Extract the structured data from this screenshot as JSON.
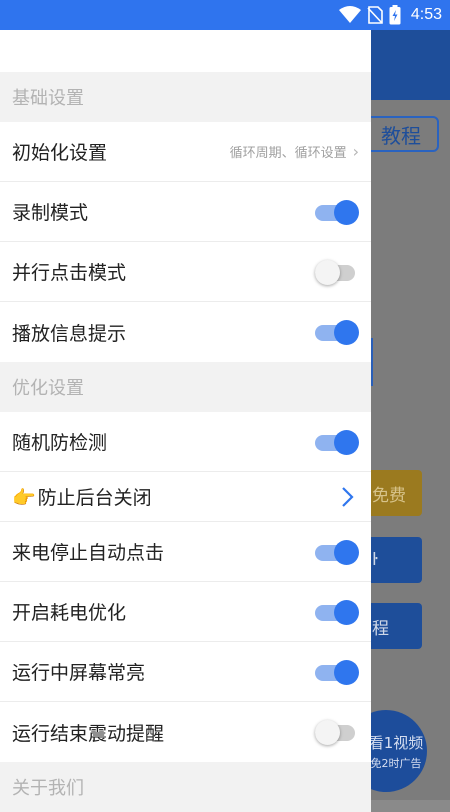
{
  "status_bar": {
    "time": "4:53"
  },
  "background_app": {
    "tutorial_button": "教程",
    "btn_free": "免费",
    "btn_a": "ŀ",
    "btn_b": "程",
    "circle_line1": "看1视频",
    "circle_line2": "免2时广告"
  },
  "drawer": {
    "sections": {
      "basic": "基础设置",
      "optimize": "优化设置",
      "about": "关于我们"
    },
    "basic_items": [
      {
        "label": "初始化设置",
        "hint": "循环周期、循环设置"
      },
      {
        "label": "录制模式",
        "toggle": "on"
      },
      {
        "label": "并行点击模式",
        "toggle": "off"
      },
      {
        "label": "播放信息提示",
        "toggle": "on"
      }
    ],
    "optimize_items": [
      {
        "label": "随机防检测",
        "toggle": "on"
      },
      {
        "label": "防止后台关闭",
        "icon": "pointing-hand-icon"
      },
      {
        "label": "来电停止自动点击",
        "toggle": "on"
      },
      {
        "label": "开启耗电优化",
        "toggle": "on"
      },
      {
        "label": "运行中屏幕常亮",
        "toggle": "on"
      },
      {
        "label": "运行结束震动提醒",
        "toggle": "off"
      }
    ]
  },
  "colors": {
    "accent": "#2f76ee",
    "status_bar": "#2f74ee",
    "section_bg": "#f2f2f2"
  }
}
